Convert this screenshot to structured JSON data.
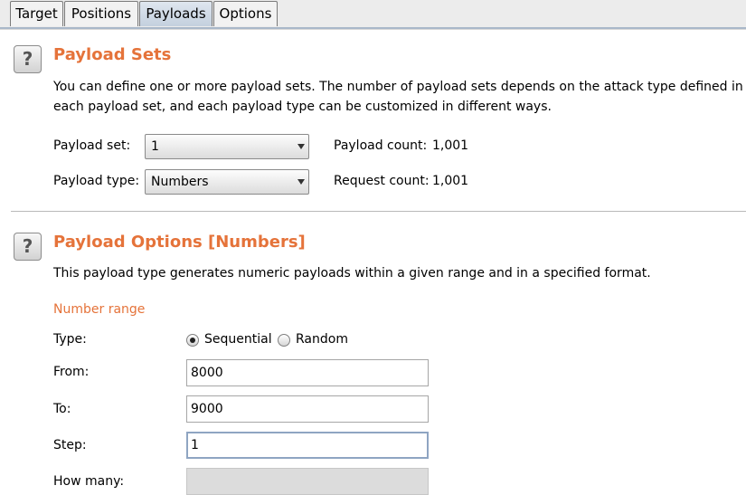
{
  "tabs": [
    {
      "label": "Target"
    },
    {
      "label": "Positions"
    },
    {
      "label": "Payloads",
      "active": true
    },
    {
      "label": "Options"
    }
  ],
  "payload_sets": {
    "help_glyph": "?",
    "title": "Payload Sets",
    "description_line1": "You can define one or more payload sets. The number of payload sets depends on the attack type defined in the",
    "description_line2": "each payload set, and each payload type can be customized in different ways.",
    "set_label": "Payload set:",
    "set_value": "1",
    "type_label": "Payload type:",
    "type_value": "Numbers",
    "payload_count_label": "Payload count:",
    "payload_count_value": "1,001",
    "request_count_label": "Request count:",
    "request_count_value": "1,001"
  },
  "payload_options": {
    "help_glyph": "?",
    "title": "Payload Options [Numbers]",
    "description": "This payload type generates numeric payloads within a given range and in a specified format.",
    "number_range_heading": "Number range",
    "type_label": "Type:",
    "type_options": [
      {
        "label": "Sequential",
        "selected": true
      },
      {
        "label": "Random",
        "selected": false
      }
    ],
    "from_label": "From:",
    "from_value": "8000",
    "to_label": "To:",
    "to_value": "9000",
    "step_label": "Step:",
    "step_value": "1",
    "how_many_label": "How many:",
    "how_many_value": ""
  },
  "colors": {
    "accent": "#e5733a",
    "active_tab": "#c9d4e1"
  }
}
